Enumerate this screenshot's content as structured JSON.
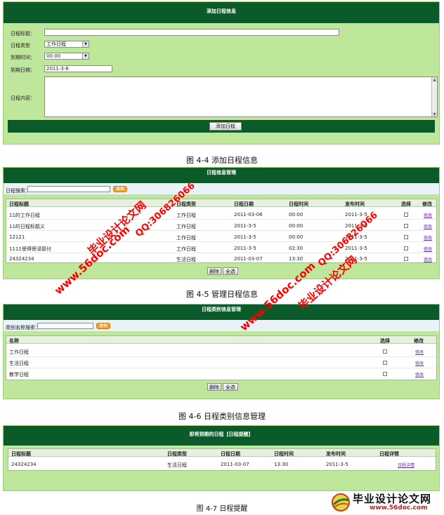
{
  "fig44": {
    "title": "添加日程信息",
    "labels": {
      "title": "日程标题：",
      "type": "日程类型",
      "time": "到期时间：",
      "date": "到期日期：",
      "content": "日程内容："
    },
    "type_value": "工作日程",
    "time_value": "00:00",
    "date_value": "2011-3-6",
    "submit": "添加日程",
    "caption": "图 4-4  添加日程信息"
  },
  "fig45": {
    "title": "日程信息管理",
    "search_label": "日程搜索：",
    "search_btn": "搜索",
    "columns": [
      "日程标题",
      "日程类型",
      "日程日期",
      "日程时间",
      "发布时间",
      "选择",
      "修改"
    ],
    "rows": [
      [
        "11的工作日程",
        "工作日程",
        "2011-03-06",
        "00:00",
        "2011-3-5",
        "",
        "修改"
      ],
      [
        "11的日程标题义",
        "工作日程",
        "2011-3-5",
        "00:00",
        "2011-3-5",
        "",
        "修改"
      ],
      [
        "12121",
        "工作日程",
        "2011-3-5",
        "00:00",
        "2011-3-5",
        "",
        "修改"
      ],
      [
        "1111傍得傍浸冒付",
        "工作日程",
        "2011-3-5",
        "02:30",
        "2011-3-5",
        "",
        "修改"
      ],
      [
        "24324234",
        "生活日程",
        "2011-03-07",
        "13:30",
        "2011-3-5",
        "",
        "修改"
      ]
    ],
    "delete": "删除",
    "select_all": "全选",
    "caption": "图 4-5 管理日程信息"
  },
  "fig46": {
    "title": "日程类别信息管理",
    "search_label": "类别名称搜索：",
    "search_btn": "搜索",
    "columns": [
      "名称",
      "选择",
      "修改"
    ],
    "rows": [
      [
        "工作日程",
        "",
        "修改"
      ],
      [
        "生活日程",
        "",
        "修改"
      ],
      [
        "教学日程",
        "",
        "修改"
      ]
    ],
    "delete": "删除",
    "select_all": "全选",
    "caption": "图 4-6 日程类别信息管理"
  },
  "fig47": {
    "title": "即将到期的日程【日程提醒】",
    "columns": [
      "日程标题",
      "日程类型",
      "日程日期",
      "日程时间",
      "发布时间",
      "日程详情"
    ],
    "rows": [
      [
        "24324234",
        "生活日程",
        "2011-03-07",
        "13:30",
        "2011-3-5",
        "日程详情"
      ]
    ],
    "caption": "图 4-7 日程提醒"
  },
  "watermarks": {
    "site_a": "毕业设计论文网",
    "qq_a": "QQ:306826066",
    "url_a": "www.56doc.com",
    "site_b": "毕业设计论文网",
    "qq_b": "QQ:306826066",
    "url_b": "www.56doc.com",
    "color": "#ff0000"
  },
  "logo": {
    "title": "毕业设计论文网",
    "url": "www.56doc.com"
  }
}
